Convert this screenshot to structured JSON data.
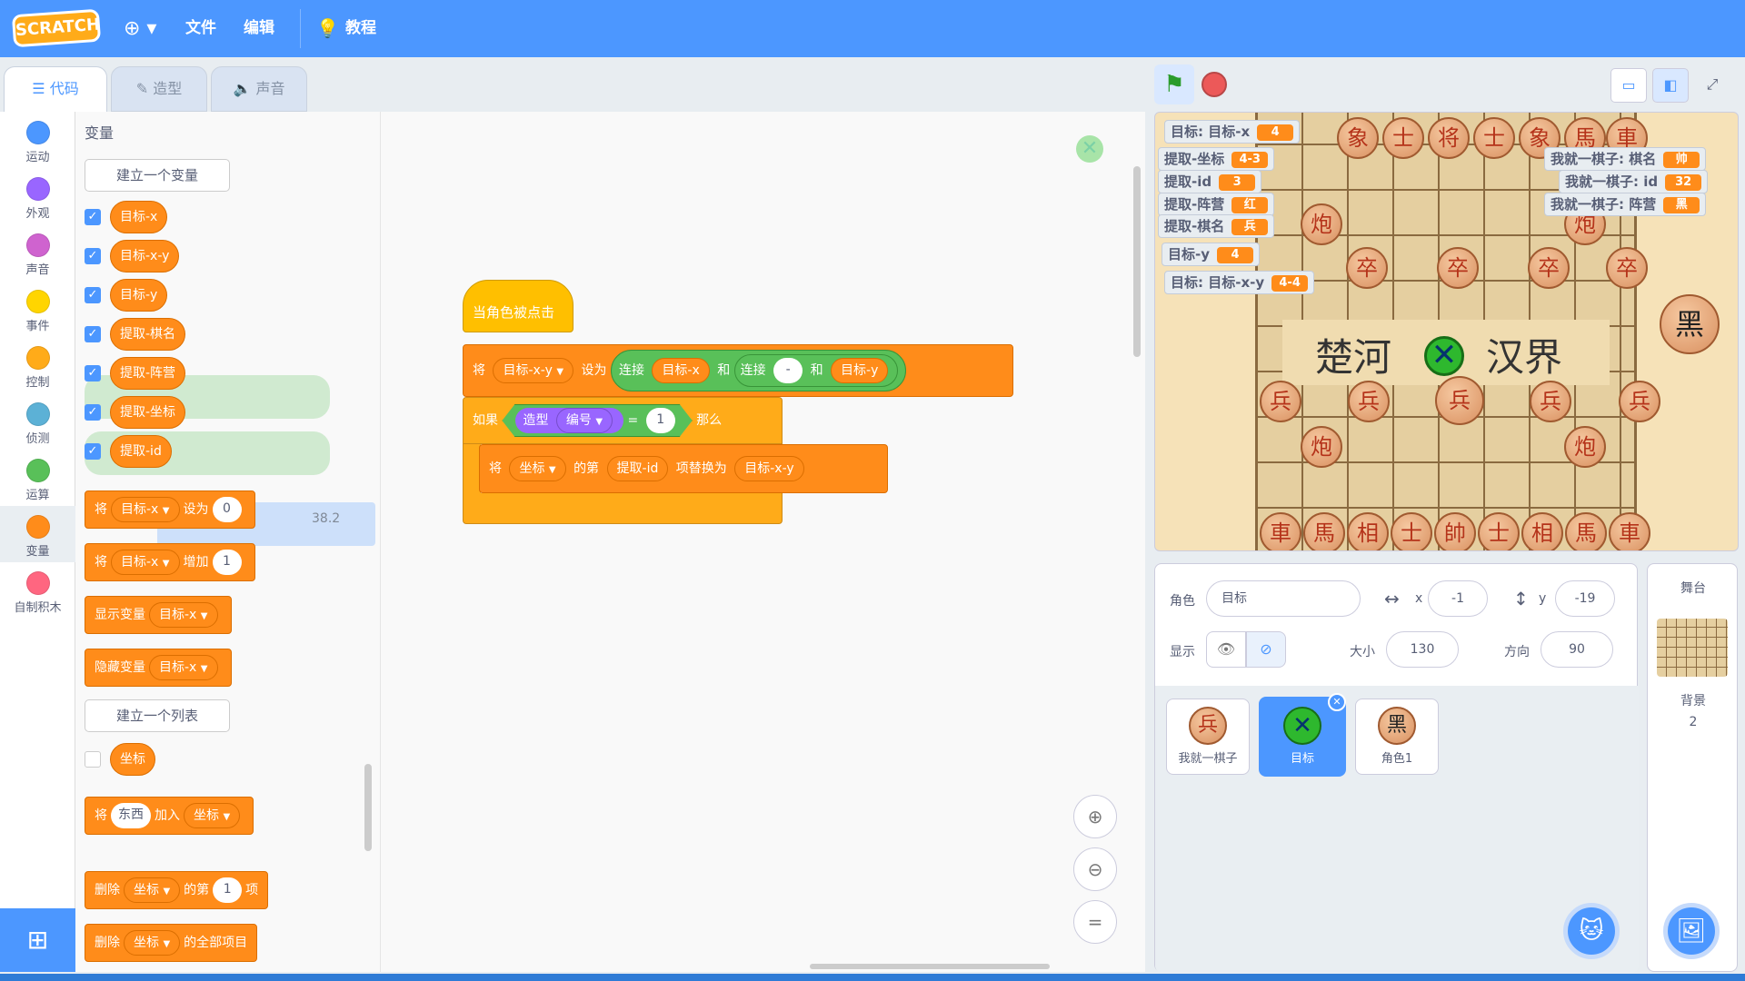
{
  "menubar": {
    "logo": "SCRATCH",
    "file": "文件",
    "edit": "编辑",
    "tutorials": "教程",
    "globe_icon": "globe-icon"
  },
  "tabs": {
    "code": "代码",
    "costumes": "造型",
    "sounds": "声音"
  },
  "categories": [
    {
      "label": "运动",
      "color": "#4c97ff"
    },
    {
      "label": "外观",
      "color": "#9966ff"
    },
    {
      "label": "声音",
      "color": "#cf63cf"
    },
    {
      "label": "事件",
      "color": "#ffd500"
    },
    {
      "label": "控制",
      "color": "#ffab19"
    },
    {
      "label": "侦测",
      "color": "#5cb1d6"
    },
    {
      "label": "运算",
      "color": "#59c059"
    },
    {
      "label": "变量",
      "color": "#ff8c1a"
    },
    {
      "label": "自制积木",
      "color": "#ff6680"
    }
  ],
  "palette": {
    "title": "变量",
    "make_variable": "建立一个变量",
    "variables": [
      "目标-x",
      "目标-x-y",
      "目标-y",
      "提取-棋名",
      "提取-阵营",
      "提取-坐标",
      "提取-id"
    ],
    "set_block": {
      "prefix": "将",
      "var": "目标-x",
      "mid": "设为",
      "value": "0"
    },
    "change_block": {
      "prefix": "将",
      "var": "目标-x",
      "mid": "增加",
      "value": "1"
    },
    "show_block": {
      "label": "显示变量",
      "var": "目标-x"
    },
    "hide_block": {
      "label": "隐藏变量",
      "var": "目标-x"
    },
    "make_list": "建立一个列表",
    "list_name": "坐标",
    "add_block": {
      "prefix": "将",
      "item": "东西",
      "mid": "加入",
      "list": "坐标"
    },
    "delete_block": {
      "prefix": "删除",
      "list": "坐标",
      "mid": "的第",
      "index": "1",
      "suffix": "项"
    },
    "delete_all_block": {
      "prefix": "删除",
      "list": "坐标",
      "suffix": "的全部项目"
    },
    "ghost_value": "38.2"
  },
  "script": {
    "hat": "当角色被点击",
    "set": {
      "prefix": "将",
      "var": "目标-x-y",
      "mid": "设为",
      "join1": "连接",
      "a": "目标-x",
      "and1": "和",
      "join2": "连接",
      "sep": "-",
      "and2": "和",
      "b": "目标-y"
    },
    "if": {
      "label": "如果",
      "costume": "造型",
      "prop": "编号",
      "eq": "=",
      "value": "1",
      "then": "那么"
    },
    "replace": {
      "prefix": "将",
      "list": "坐标",
      "mid": "的第",
      "index": "提取-id",
      "mid2": "项替换为",
      "value": "目标-x-y"
    }
  },
  "stage_controls": {
    "flag": "green-flag-icon",
    "stop": "stop-icon"
  },
  "monitors": [
    {
      "label": "目标: 目标-x",
      "value": "4"
    },
    {
      "label": "提取-坐标",
      "value": "4-3"
    },
    {
      "label": "提取-id",
      "value": "3"
    },
    {
      "label": "提取-阵营",
      "value": "红"
    },
    {
      "label": "提取-棋名",
      "value": "兵"
    },
    {
      "label": "目标-y",
      "value": "4"
    },
    {
      "label": "目标: 目标-x-y",
      "value": "4-4"
    },
    {
      "label": "我就一棋子: 棋名",
      "value": "帅"
    },
    {
      "label": "我就一棋子: id",
      "value": "32"
    },
    {
      "label": "我就一棋子: 阵营",
      "value": "黑"
    }
  ],
  "board": {
    "river_left": "楚河",
    "river_right": "汉界",
    "black_badge": "黑",
    "top_row": [
      "象",
      "士",
      "将",
      "士",
      "象",
      "馬",
      "車"
    ],
    "cannon": "炮",
    "soldier_black": "卒",
    "soldier_red": "兵",
    "bottom_row": [
      "車",
      "馬",
      "相",
      "士",
      "帥",
      "士",
      "相",
      "馬",
      "車"
    ]
  },
  "sprite_info": {
    "sprite_label": "角色",
    "sprite_name": "目标",
    "x_label": "x",
    "x": "-1",
    "y_label": "y",
    "y": "-19",
    "show_label": "显示",
    "size_label": "大小",
    "size": "130",
    "direction_label": "方向",
    "direction": "90"
  },
  "sprites": [
    {
      "name": "我就一棋子",
      "glyph": "兵"
    },
    {
      "name": "目标",
      "glyph": ""
    },
    {
      "name": "角色1",
      "glyph": "黑"
    }
  ],
  "backdrop": {
    "title": "舞台",
    "label": "背景",
    "count": "2"
  }
}
